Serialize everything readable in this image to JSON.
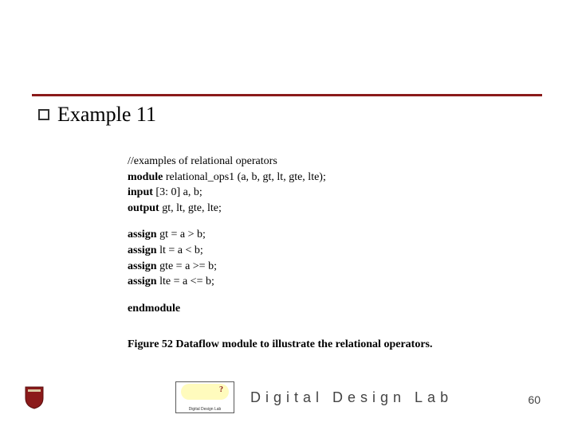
{
  "title": "Example 11",
  "code": {
    "l1_comment": "//examples of relational operators",
    "l2_kw": "module",
    "l2_rest": " relational_ops1 (a, b, gt, lt, gte, lte);",
    "l3_kw": "input",
    "l3_rest": " [3: 0] a, b;",
    "l4_kw": "output",
    "l4_rest": " gt, lt, gte, lte;",
    "l5_kw": "assign",
    "l5_rest": " gt = a > b;",
    "l6_kw": "assign",
    "l6_rest": " lt = a < b;",
    "l7_kw": "assign",
    "l7_rest": " gte = a >= b;",
    "l8_kw": "assign",
    "l8_rest": " lte = a <= b;",
    "l9_kw": "endmodule"
  },
  "caption": "Figure 52 Dataflow module to illustrate the relational operators.",
  "footer": {
    "lab_text": "Digital Design Lab",
    "logo_mini": "Digital Design Lab",
    "page_number": "60"
  }
}
